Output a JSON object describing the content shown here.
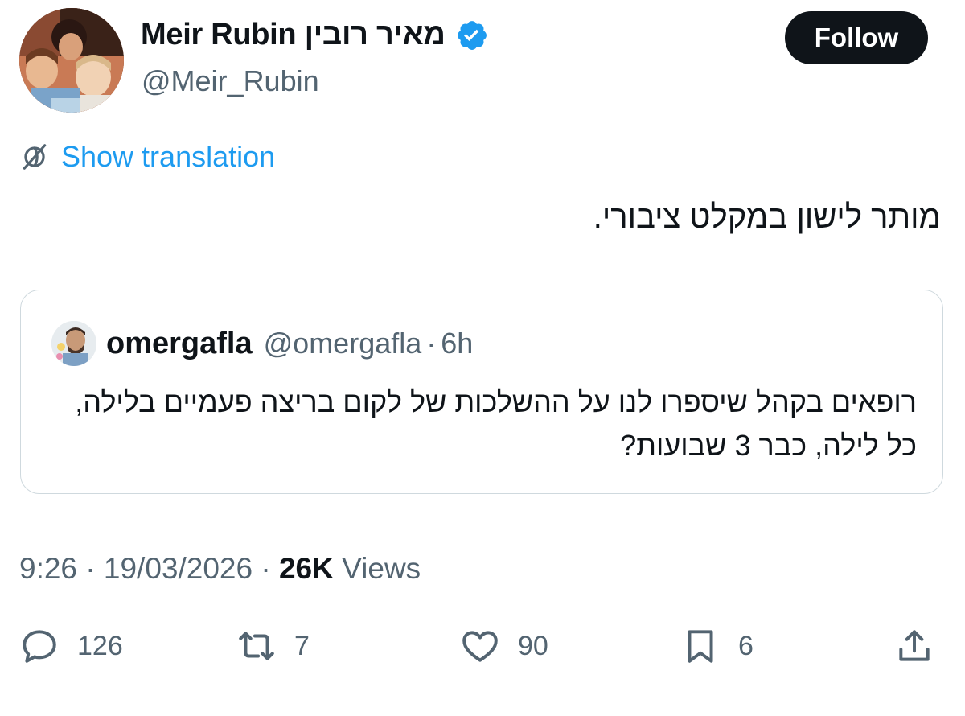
{
  "author": {
    "name": "Meir Rubin מאיר רובין",
    "handle": "@Meir_Rubin",
    "verified": true
  },
  "follow_label": "Follow",
  "translation_label": "Show translation",
  "tweet": {
    "text": "מותר לישון במקלט ציבורי."
  },
  "quoted": {
    "name": "omergafla",
    "handle": "@omergafla",
    "separator": "·",
    "time": "6h",
    "text": "רופאים בקהל שיספרו לנו על ההשלכות של לקום בריצה פעמיים בלילה, כל לילה, כבר 3 שבועות?"
  },
  "meta": {
    "time": "9:26",
    "sep1": "·",
    "date": "19/03/2026",
    "sep2": "·",
    "views_count": "26K",
    "views_label": "Views"
  },
  "actions": {
    "replies": "126",
    "reposts": "7",
    "likes": "90",
    "bookmarks": "6"
  },
  "icons": [
    "verified-badge-icon",
    "globe-icon",
    "reply-icon",
    "retweet-icon",
    "heart-icon",
    "bookmark-icon",
    "share-icon"
  ],
  "colors": {
    "link": "#1d9bf0",
    "secondary_text": "#536471",
    "primary_text": "#0f1419",
    "border": "#cfd9de",
    "follow_bg": "#0f1419"
  }
}
